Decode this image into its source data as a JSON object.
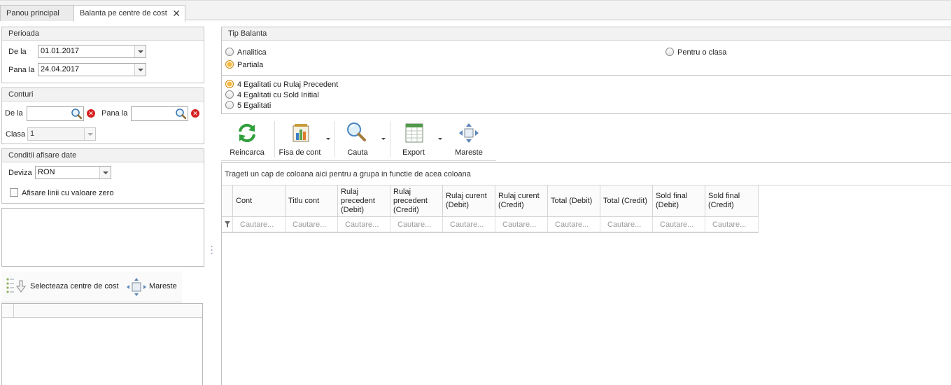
{
  "tabs": [
    "Panou principal",
    "Balanta pe centre de cost"
  ],
  "tab_close": "✕",
  "perioada": {
    "title": "Perioada",
    "from_label": "De la",
    "from_value": "01.01.2017",
    "to_label": "Pana la",
    "to_value": "24.04.2017"
  },
  "conturi": {
    "title": "Conturi",
    "from_label": "De la",
    "to_label": "Pana la",
    "clasa_label": "Clasa",
    "clasa_value": "1"
  },
  "conditii": {
    "title": "Conditii afisare date",
    "deviza_label": "Deviza",
    "deviza_value": "RON",
    "zero_label": "Afisare linii cu valoare zero"
  },
  "cost_toolbar": {
    "select_label": "Selecteaza centre de cost",
    "expand_label": "Mareste"
  },
  "tip_balanta": {
    "title": "Tip Balanta",
    "options": [
      "Analitica",
      "Partiala",
      "Pentru o clasa"
    ],
    "selected": "Partiala",
    "egalitati": [
      "4 Egalitati cu Rulaj Precedent",
      "4 Egalitati cu Sold Initial",
      "5 Egalitati"
    ],
    "egalitati_selected": "4 Egalitati cu Rulaj Precedent"
  },
  "main_toolbar": {
    "buttons": [
      {
        "label": "Reincarca",
        "icon": "refresh-icon"
      },
      {
        "label": "Fisa de cont",
        "icon": "account-sheet-icon"
      },
      {
        "label": "Cauta",
        "icon": "search-icon"
      },
      {
        "label": "Export",
        "icon": "spreadsheet-icon"
      },
      {
        "label": "Mareste",
        "icon": "expand-icon"
      }
    ]
  },
  "grid": {
    "group_hint": "Trageti un cap de coloana aici pentru a grupa in functie de acea coloana",
    "columns": [
      "Cont",
      "Titlu cont",
      "Rulaj precedent (Debit)",
      "Rulaj precedent (Credit)",
      "Rulaj curent (Debit)",
      "Rulaj curent (Credit)",
      "Total (Debit)",
      "Total (Credit)",
      "Sold final (Debit)",
      "Sold final (Credit)"
    ],
    "filter_placeholder": "Cautare..."
  },
  "colors": {
    "accent_radio": "#f6b73c",
    "clear_red": "#d42020",
    "refresh_green": "#2e9e3a"
  }
}
